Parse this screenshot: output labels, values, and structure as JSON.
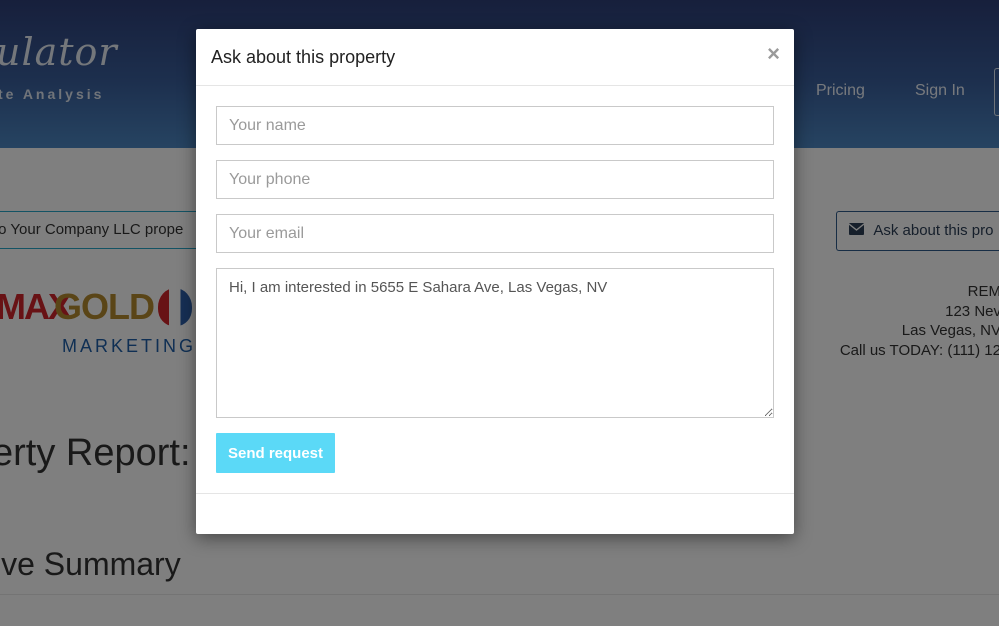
{
  "header": {
    "logo_text": "ulator",
    "logo_tagline": "te Analysis",
    "nav": [
      "Pricing",
      "Sign In"
    ]
  },
  "page": {
    "share_button": "to Your Company LLC prope",
    "ask_button": "Ask about this pro",
    "brand_logo": {
      "max": "MAX",
      "gold": "GOLD",
      "marketing": "MARKETING"
    },
    "company": {
      "name": "REM",
      "street": "123 Nev",
      "city": "Las Vegas, NV",
      "phone": "Call us TODAY: (111) 12"
    },
    "report_title": "erty Report: P",
    "summary_title": "ive Summary"
  },
  "modal": {
    "title": "Ask about this property",
    "close": "×",
    "name_placeholder": "Your name",
    "phone_placeholder": "Your phone",
    "email_placeholder": "Your email",
    "message": "Hi, I am interested in 5655 E Sahara Ave, Las Vegas, NV",
    "send_label": "Send request"
  },
  "colors": {
    "header_top": "#2e3f78",
    "header_bottom": "#4d88c4",
    "send_button": "#5bd9f7",
    "backdrop": "rgba(0,0,0,0.5)"
  }
}
